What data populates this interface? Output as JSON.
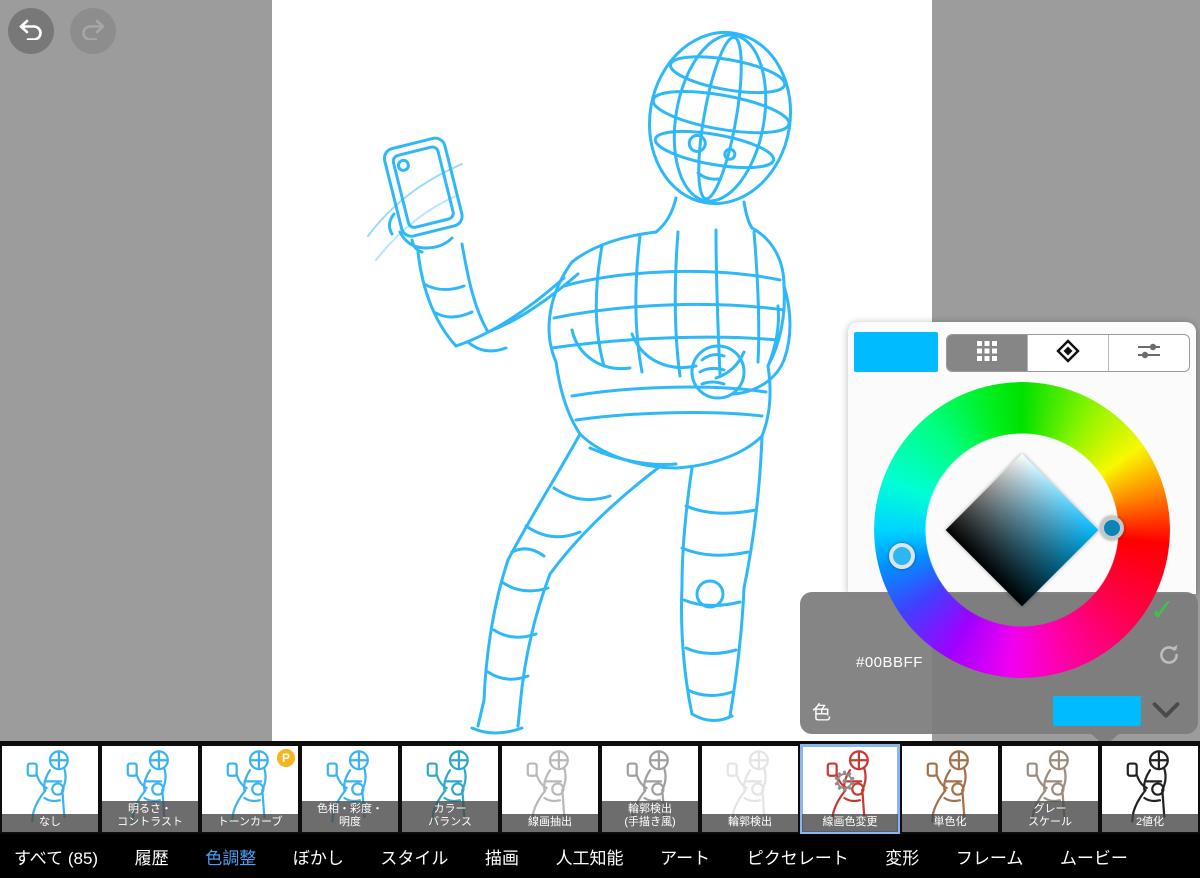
{
  "accent_color": "#4aa0f5",
  "color_panel": {
    "current_color": "#00BBFF",
    "hex_label": "#00BBFF",
    "color_row_label": "色",
    "check_icon": "✓",
    "tabs": [
      {
        "name": "palette-grid"
      },
      {
        "name": "hsv-diamond",
        "selected": true
      },
      {
        "name": "sliders"
      }
    ]
  },
  "filters": {
    "gear_icon": "⚙",
    "items": [
      {
        "label": "なし",
        "color": "#3bb3ef"
      },
      {
        "label": "明るさ・\nコントラスト",
        "color": "#3bb3ef"
      },
      {
        "label": "トーンカーブ",
        "color": "#3bb3ef",
        "badge": "P"
      },
      {
        "label": "色相・彩度・\n明度",
        "color": "#3bb3ef"
      },
      {
        "label": "カラー\nバランス",
        "color": "#2fa8c9"
      },
      {
        "label": "線画抽出",
        "color": "#b9b9b9"
      },
      {
        "label": "輪郭検出\n(手描き風)",
        "color": "#a0a0a0"
      },
      {
        "label": "輪郭検出",
        "color": "#e4e4e4"
      },
      {
        "label": "線画色変更",
        "color": "#c63a31",
        "selected": true
      },
      {
        "label": "単色化",
        "color": "#a4714c"
      },
      {
        "label": "グレー\nスケール",
        "color": "#9c8c7c"
      },
      {
        "label": "2値化",
        "color": "#222222"
      }
    ]
  },
  "bottom_bar": {
    "items": [
      {
        "label": "すべて (85)"
      },
      {
        "label": "履歴"
      },
      {
        "label": "色調整",
        "active": true
      },
      {
        "label": "ぼかし"
      },
      {
        "label": "スタイル"
      },
      {
        "label": "描画"
      },
      {
        "label": "人工知能"
      },
      {
        "label": "アート"
      },
      {
        "label": "ピクセレート"
      },
      {
        "label": "変形"
      },
      {
        "label": "フレーム"
      },
      {
        "label": "ムービー"
      }
    ]
  }
}
